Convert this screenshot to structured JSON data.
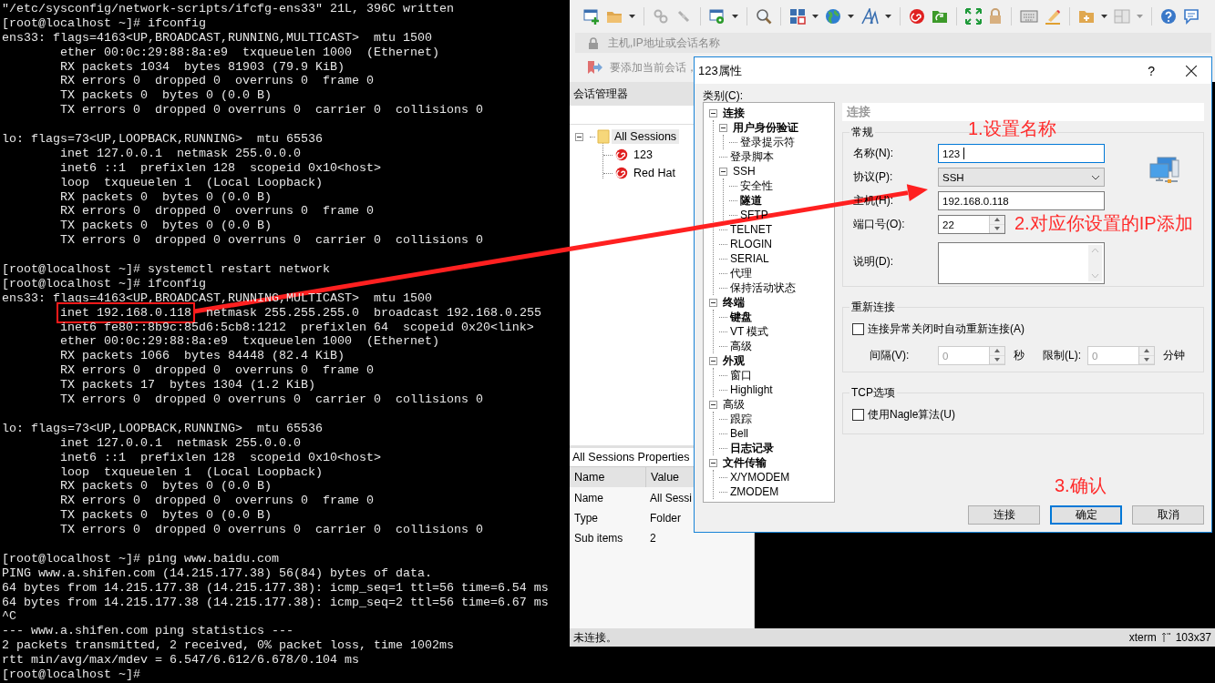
{
  "terminal": {
    "blocks": [
      [
        "\"/etc/sysconfig/network-scripts/ifcfg-ens33\" 21L, 396C written",
        "[root@localhost ~]# ifconfig",
        "ens33: flags=4163<UP,BROADCAST,RUNNING,MULTICAST>  mtu 1500",
        "        ether 00:0c:29:88:8a:e9  txqueuelen 1000  (Ethernet)",
        "        RX packets 1034  bytes 81903 (79.9 KiB)",
        "        RX errors 0  dropped 0  overruns 0  frame 0",
        "        TX packets 0  bytes 0 (0.0 B)",
        "        TX errors 0  dropped 0 overruns 0  carrier 0  collisions 0"
      ],
      [
        "lo: flags=73<UP,LOOPBACK,RUNNING>  mtu 65536",
        "        inet 127.0.0.1  netmask 255.0.0.0",
        "        inet6 ::1  prefixlen 128  scopeid 0x10<host>",
        "        loop  txqueuelen 1  (Local Loopback)",
        "        RX packets 0  bytes 0 (0.0 B)",
        "        RX errors 0  dropped 0  overruns 0  frame 0",
        "        TX packets 0  bytes 0 (0.0 B)",
        "        TX errors 0  dropped 0 overruns 0  carrier 0  collisions 0"
      ],
      [
        "[root@localhost ~]# systemctl restart network",
        "[root@localhost ~]# ifconfig",
        "ens33: flags=4163<UP,BROADCAST,RUNNING,MULTICAST>  mtu 1500",
        {
          "marked": "inet 192.168.0.118",
          "text": "  netmask 255.255.255.0  broadcast 192.168.0.255"
        },
        "        inet6 fe80::8b9c:85d6:5cb8:1212  prefixlen 64  scopeid 0x20<link>",
        "        ether 00:0c:29:88:8a:e9  txqueuelen 1000  (Ethernet)",
        "        RX packets 1066  bytes 84448 (82.4 KiB)",
        "        RX errors 0  dropped 0  overruns 0  frame 0",
        "        TX packets 17  bytes 1304 (1.2 KiB)",
        "        TX errors 0  dropped 0 overruns 0  carrier 0  collisions 0"
      ],
      [
        "lo: flags=73<UP,LOOPBACK,RUNNING>  mtu 65536",
        "        inet 127.0.0.1  netmask 255.0.0.0",
        "        inet6 ::1  prefixlen 128  scopeid 0x10<host>",
        "        loop  txqueuelen 1  (Local Loopback)",
        "        RX packets 0  bytes 0 (0.0 B)",
        "        RX errors 0  dropped 0  overruns 0  frame 0",
        "        TX packets 0  bytes 0 (0.0 B)",
        "        TX errors 0  dropped 0 overruns 0  carrier 0  collisions 0"
      ],
      [
        "[root@localhost ~]# ping www.baidu.com",
        "PING www.a.shifen.com (14.215.177.38) 56(84) bytes of data.",
        "64 bytes from 14.215.177.38 (14.215.177.38): icmp_seq=1 ttl=56 time=6.54 ms",
        "64 bytes from 14.215.177.38 (14.215.177.38): icmp_seq=2 ttl=56 time=6.67 ms",
        "^C",
        "--- www.a.shifen.com ping statistics ---",
        "2 packets transmitted, 2 received, 0% packet loss, time 1002ms",
        "rtt min/avg/max/mdev = 6.547/6.612/6.678/0.104 ms",
        "[root@localhost ~]#"
      ]
    ]
  },
  "session_window": {
    "address_placeholder": "主机,IP地址或会话名称",
    "link_bar_text": "要添加当前会话，",
    "session_manager": {
      "title": "会话管理器",
      "tree": [
        {
          "label": "All Sessions",
          "selected": true,
          "expanded": true,
          "children": [
            {
              "label": "123",
              "selected": false
            },
            {
              "label": "Red Hat",
              "selected": false
            }
          ]
        }
      ]
    },
    "properties": {
      "title": "All Sessions Properties",
      "columns": [
        "Name",
        "Value"
      ],
      "rows": [
        {
          "name": "Name",
          "value": "All Sessi"
        },
        {
          "name": "Type",
          "value": "Folder"
        },
        {
          "name": "Sub items",
          "value": "2"
        }
      ]
    },
    "status_bar": {
      "message": "未连接。",
      "terminal_type": "xterm",
      "size": "103x37"
    }
  },
  "dialog": {
    "title": "123属性",
    "help": "?",
    "category_label": "类别(C):",
    "categories": [
      {
        "label": "连接",
        "bold": true,
        "expanded": true,
        "children": [
          {
            "label": "用户身份验证",
            "bold": true,
            "expanded": true,
            "children": [
              {
                "label": "登录提示符",
                "bold": false
              }
            ]
          },
          {
            "label": "登录脚本",
            "bold": false
          },
          {
            "label": "SSH",
            "bold": false,
            "expanded": true,
            "children": [
              {
                "label": "安全性",
                "bold": false
              },
              {
                "label": "隧道",
                "bold": true
              },
              {
                "label": "SFTP",
                "bold": false
              }
            ]
          },
          {
            "label": "TELNET",
            "bold": false
          },
          {
            "label": "RLOGIN",
            "bold": false
          },
          {
            "label": "SERIAL",
            "bold": false
          },
          {
            "label": "代理",
            "bold": false
          },
          {
            "label": "保持活动状态",
            "bold": false
          }
        ]
      },
      {
        "label": "终端",
        "bold": true,
        "expanded": true,
        "children": [
          {
            "label": "键盘",
            "bold": true
          },
          {
            "label": "VT 模式",
            "bold": false
          },
          {
            "label": "高级",
            "bold": false
          }
        ]
      },
      {
        "label": "外观",
        "bold": true,
        "expanded": true,
        "children": [
          {
            "label": "窗口",
            "bold": false
          },
          {
            "label": "Highlight",
            "bold": false
          }
        ]
      },
      {
        "label": "高级",
        "bold": false,
        "expanded": true,
        "children": [
          {
            "label": "跟踪",
            "bold": false
          },
          {
            "label": "Bell",
            "bold": false
          },
          {
            "label": "日志记录",
            "bold": true
          }
        ]
      },
      {
        "label": "文件传输",
        "bold": true,
        "expanded": true,
        "children": [
          {
            "label": "X/YMODEM",
            "bold": false
          },
          {
            "label": "ZMODEM",
            "bold": false
          }
        ]
      }
    ],
    "section_title": "连接",
    "general": {
      "title": "常规",
      "fields": [
        {
          "kind": "text",
          "label": "名称(N):",
          "value": "123",
          "focused": true
        },
        {
          "kind": "select",
          "label": "协议(P):",
          "value": "SSH",
          "focused": false
        },
        {
          "kind": "text",
          "label": "主机(H):",
          "value": "192.168.0.118",
          "focused": false
        },
        {
          "kind": "spinner",
          "label": "端口号(O):",
          "value": "22",
          "focused": false
        },
        {
          "kind": "textarea",
          "label": "说明(D):",
          "focused": false
        }
      ]
    },
    "reconnect": {
      "title": "重新连接",
      "checkbox": {
        "label": "连接异常关闭时自动重新连接(A)",
        "checked": false
      },
      "interval": {
        "label": "间隔(V):",
        "value": "0",
        "unit": "秒",
        "disabled": true
      },
      "limit": {
        "label": "限制(L):",
        "value": "0",
        "unit": "分钟",
        "disabled": true
      }
    },
    "tcp": {
      "title": "TCP选项",
      "checkbox": {
        "label": "使用Nagle算法(U)",
        "checked": false
      }
    },
    "buttons": [
      {
        "label": "连接",
        "default": false
      },
      {
        "label": "确定",
        "default": true
      },
      {
        "label": "取消",
        "default": false
      }
    ]
  },
  "annotations": [
    {
      "text": "1.设置名称"
    },
    {
      "text": "2.对应你设置的IP添加"
    },
    {
      "text": "3.确认"
    }
  ]
}
